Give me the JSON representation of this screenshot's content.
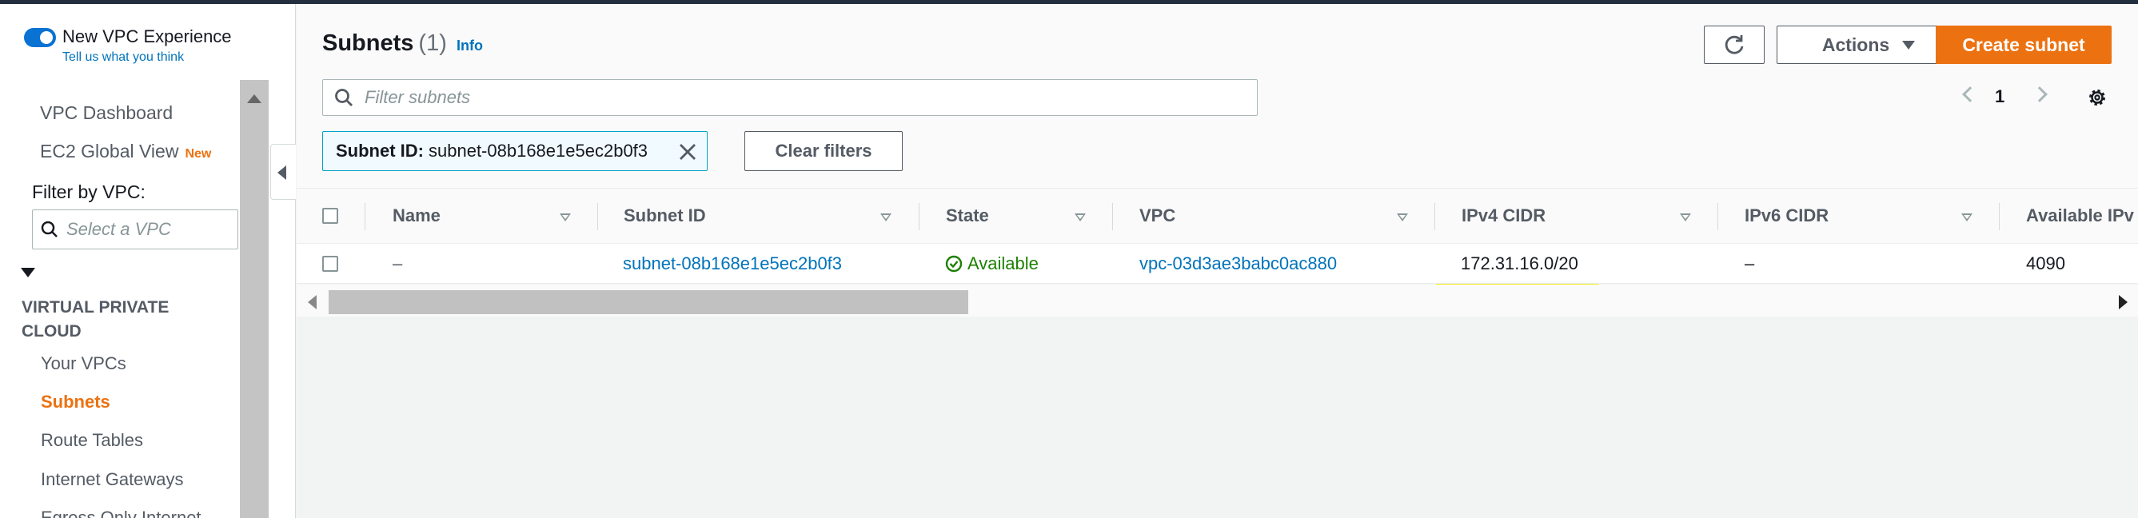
{
  "sidebar": {
    "new_vpc_experience": "New VPC Experience",
    "feedback_link": "Tell us what you think",
    "top_items": [
      {
        "label": "VPC Dashboard"
      },
      {
        "label": "EC2 Global View",
        "badge": "New"
      }
    ],
    "filter_label": "Filter by VPC:",
    "filter_placeholder": "Select a VPC",
    "section_title": "VIRTUAL PRIVATE CLOUD",
    "items": [
      {
        "label": "Your VPCs"
      },
      {
        "label": "Subnets",
        "active": true
      },
      {
        "label": "Route Tables"
      },
      {
        "label": "Internet Gateways"
      },
      {
        "label": "Egress Only Internet"
      }
    ]
  },
  "header": {
    "title": "Subnets",
    "count": "(1)",
    "info": "Info",
    "actions_label": "Actions",
    "create_label": "Create subnet",
    "search_placeholder": "Filter subnets",
    "page_number": "1",
    "filter_token_key": "Subnet ID:",
    "filter_token_value": "subnet-08b168e1e5ec2b0f3",
    "clear_filters": "Clear filters"
  },
  "table": {
    "columns": [
      "Name",
      "Subnet ID",
      "State",
      "VPC",
      "IPv4 CIDR",
      "IPv6 CIDR",
      "Available IPv"
    ],
    "rows": [
      {
        "name": "–",
        "subnet_id": "subnet-08b168e1e5ec2b0f3",
        "state": "Available",
        "vpc": "vpc-03d3ae3babc0ac880",
        "ipv4_cidr": "172.31.16.0/20",
        "ipv6_cidr": "–",
        "available_ips": "4090"
      }
    ]
  },
  "colors": {
    "accent_orange": "#ec7211",
    "link_blue": "#0073bb",
    "status_green": "#1d8102",
    "highlight_yellow": "#f4ec14"
  }
}
